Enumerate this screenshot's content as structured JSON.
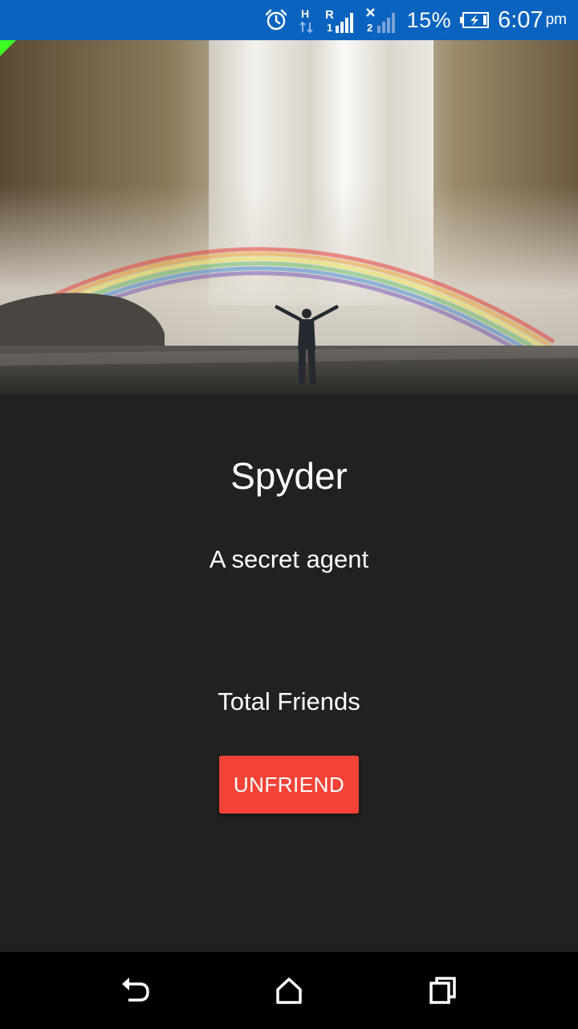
{
  "status_bar": {
    "icons": [
      "alarm-icon",
      "network-h-icon",
      "signal-sim1-icon",
      "signal-sim2-icon",
      "battery-charging-icon"
    ],
    "battery": "15%",
    "time": "6:07",
    "ampm": "pm",
    "bg_color": "#0a63bf"
  },
  "hero": {
    "image": "waterfall-rainbow-person-photo"
  },
  "profile": {
    "name": "Spyder",
    "tagline": "A secret agent",
    "friends_label": "Total Friends",
    "unfriend_label": "UNFRIEND",
    "button_color": "#f44336",
    "background_color": "#212121"
  },
  "nav_bar": {
    "icons": [
      "back-icon",
      "home-icon",
      "recents-icon"
    ]
  }
}
